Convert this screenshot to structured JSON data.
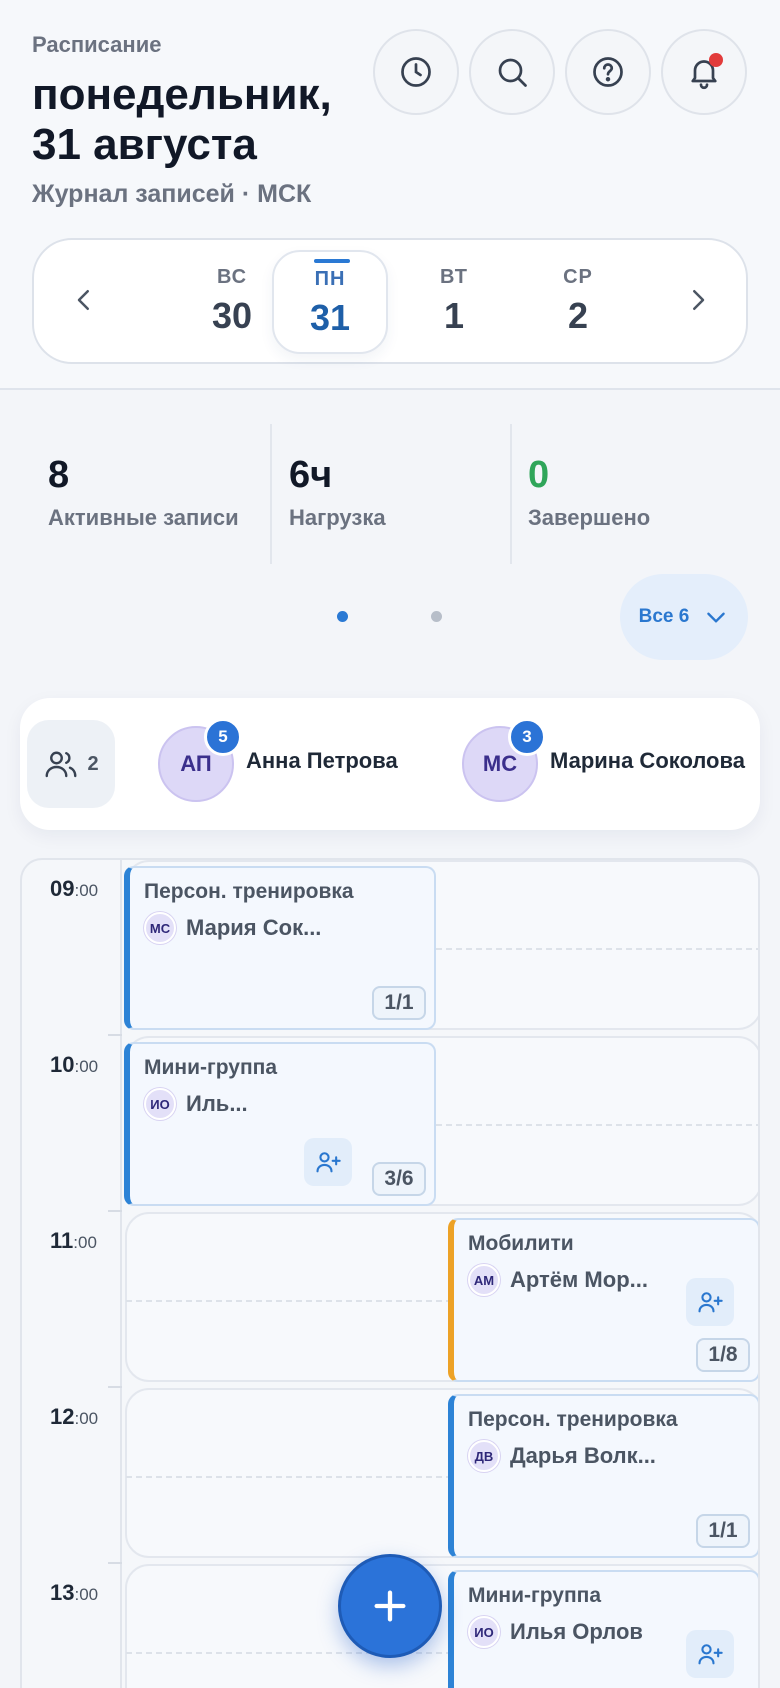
{
  "header": {
    "kicker": "Расписание",
    "title": "понедельник, 31 августа",
    "subtitle": "Журнал записей · МСК",
    "buttons": [
      "clock-icon",
      "search-icon",
      "help-icon",
      "bell-icon"
    ]
  },
  "date_strip": {
    "days": [
      {
        "dow": "ВС",
        "num": "30"
      },
      {
        "dow": "ПН",
        "num": "31",
        "active": true
      },
      {
        "dow": "ВТ",
        "num": "1"
      },
      {
        "dow": "СР",
        "num": "2"
      }
    ]
  },
  "stats": [
    {
      "value": "8",
      "label": "Активные записи",
      "color": "#111827"
    },
    {
      "value": "6ч",
      "label": "Нагрузка",
      "color": "#111827"
    },
    {
      "value": "0",
      "label": "Завершено",
      "color": "#2fa55a"
    }
  ],
  "pager": {
    "active_index": 0,
    "count": 2
  },
  "all_button": "Все 6",
  "staff": {
    "count": "2",
    "members": [
      {
        "initials": "АП",
        "name": "Анна Петрова",
        "badge": "5"
      },
      {
        "initials": "МС",
        "name": "Марина Соколова",
        "badge": "3"
      }
    ]
  },
  "timeline": {
    "hours": [
      {
        "h": "09",
        "m": ":00"
      },
      {
        "h": "10",
        "m": ":00"
      },
      {
        "h": "11",
        "m": ":00"
      },
      {
        "h": "12",
        "m": ":00"
      },
      {
        "h": "13",
        "m": ":00"
      }
    ],
    "events": [
      {
        "title": "Персон. тренировка",
        "initials": "МС",
        "person": "Мария Сок...",
        "capacity": "1/1",
        "color": "#2d83d6",
        "add": false
      },
      {
        "title": "Мини-группа",
        "initials": "ИО",
        "person": "Иль...",
        "capacity": "3/6",
        "color": "#2d83d6",
        "add": true
      },
      {
        "title": "Мобилити",
        "initials": "АМ",
        "person": "Артём Мор...",
        "capacity": "1/8",
        "color": "#eda226",
        "add": true
      },
      {
        "title": "Персон. тренировка",
        "initials": "ДВ",
        "person": "Дарья Волк...",
        "capacity": "1/1",
        "color": "#2d83d6",
        "add": false
      },
      {
        "title": "Мини-группа",
        "initials": "ИО",
        "person": "Илья Орлов",
        "capacity": "",
        "color": "#2d83d6",
        "add": true
      }
    ]
  },
  "colors": {
    "accent": "#2b73d9",
    "success": "#2fa55a",
    "warning": "#eda226",
    "danger": "#e23b3b"
  }
}
